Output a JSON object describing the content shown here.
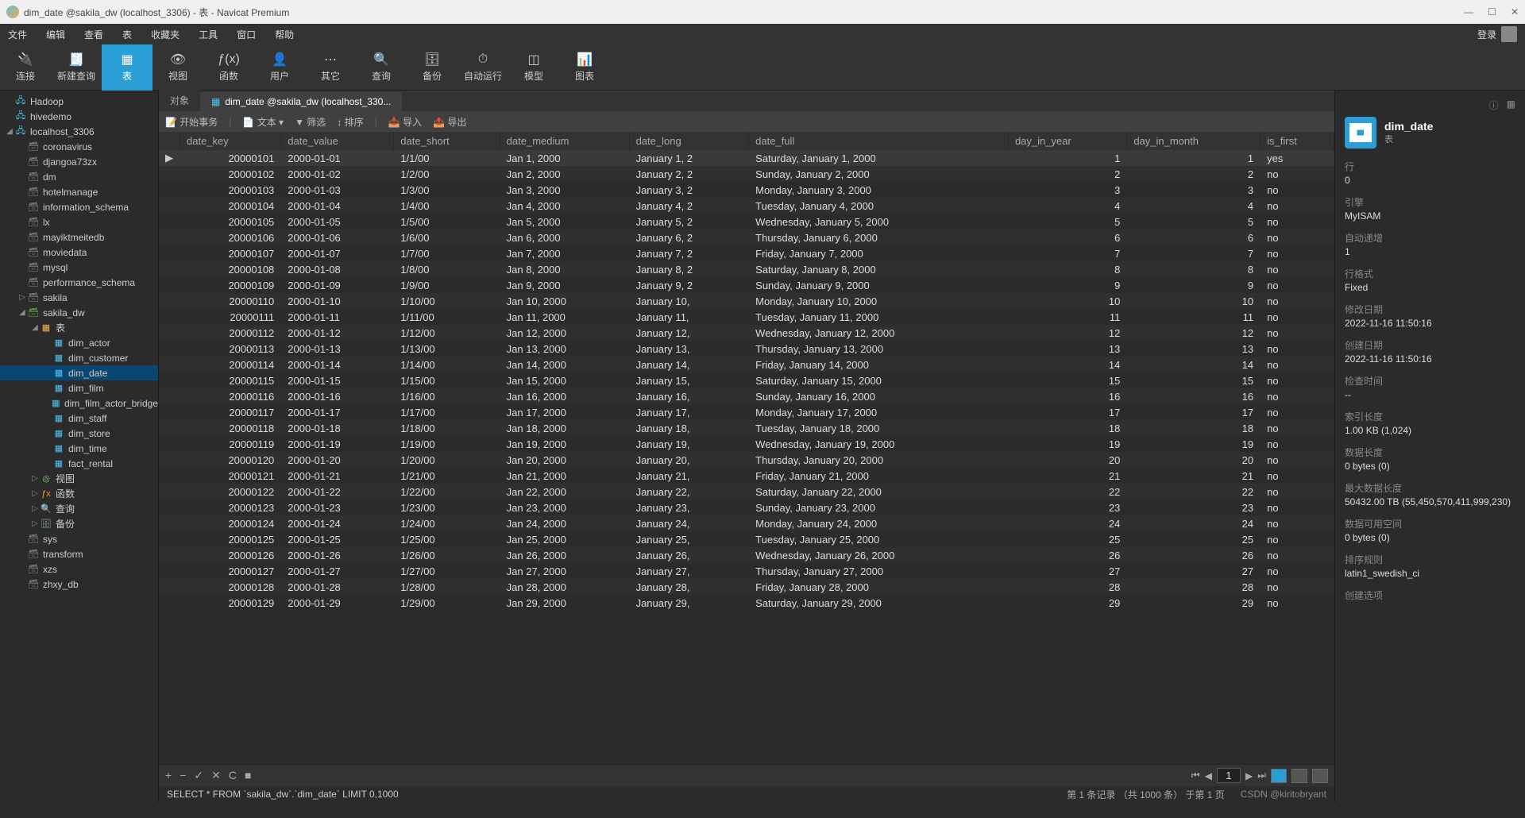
{
  "title": "dim_date @sakila_dw (localhost_3306) - 表 - Navicat Premium",
  "menu": [
    "文件",
    "编辑",
    "查看",
    "表",
    "收藏夹",
    "工具",
    "窗口",
    "帮助"
  ],
  "login": "登录",
  "toolbar": [
    {
      "label": "连接",
      "icon": "🔌"
    },
    {
      "label": "新建查询",
      "icon": "🧾"
    },
    {
      "label": "表",
      "icon": "▦",
      "active": true
    },
    {
      "label": "视图",
      "icon": "👁"
    },
    {
      "label": "函数",
      "icon": "ƒ(x)"
    },
    {
      "label": "用户",
      "icon": "👤"
    },
    {
      "label": "其它",
      "icon": "⋯"
    },
    {
      "label": "查询",
      "icon": "🔍"
    },
    {
      "label": "备份",
      "icon": "🗄"
    },
    {
      "label": "自动运行",
      "icon": "⏱"
    },
    {
      "label": "模型",
      "icon": "◫"
    },
    {
      "label": "图表",
      "icon": "📊"
    }
  ],
  "tree": [
    {
      "d": 0,
      "tw": "",
      "ic": "ic-conn",
      "glyph": "🖧",
      "label": "Hadoop"
    },
    {
      "d": 0,
      "tw": "",
      "ic": "ic-conn",
      "glyph": "🖧",
      "label": "hivedemo"
    },
    {
      "d": 0,
      "tw": "◢",
      "ic": "ic-conn",
      "glyph": "🖧",
      "label": "localhost_3306"
    },
    {
      "d": 1,
      "tw": "",
      "ic": "ic-dbgrey",
      "glyph": "🗃",
      "label": "coronavirus"
    },
    {
      "d": 1,
      "tw": "",
      "ic": "ic-dbgrey",
      "glyph": "🗃",
      "label": "djangoa73zx"
    },
    {
      "d": 1,
      "tw": "",
      "ic": "ic-dbgrey",
      "glyph": "🗃",
      "label": "dm"
    },
    {
      "d": 1,
      "tw": "",
      "ic": "ic-dbgrey",
      "glyph": "🗃",
      "label": "hotelmanage"
    },
    {
      "d": 1,
      "tw": "",
      "ic": "ic-dbgrey",
      "glyph": "🗃",
      "label": "information_schema"
    },
    {
      "d": 1,
      "tw": "",
      "ic": "ic-dbgrey",
      "glyph": "🗃",
      "label": "lx"
    },
    {
      "d": 1,
      "tw": "",
      "ic": "ic-dbgrey",
      "glyph": "🗃",
      "label": "mayiktmeitedb"
    },
    {
      "d": 1,
      "tw": "",
      "ic": "ic-dbgrey",
      "glyph": "🗃",
      "label": "moviedata"
    },
    {
      "d": 1,
      "tw": "",
      "ic": "ic-dbgrey",
      "glyph": "🗃",
      "label": "mysql"
    },
    {
      "d": 1,
      "tw": "",
      "ic": "ic-dbgrey",
      "glyph": "🗃",
      "label": "performance_schema"
    },
    {
      "d": 1,
      "tw": "▷",
      "ic": "ic-dbgrey",
      "glyph": "🗃",
      "label": "sakila"
    },
    {
      "d": 1,
      "tw": "◢",
      "ic": "ic-db",
      "glyph": "🗃",
      "label": "sakila_dw"
    },
    {
      "d": 2,
      "tw": "◢",
      "ic": "ic-folder",
      "glyph": "▦",
      "label": "表"
    },
    {
      "d": 3,
      "tw": "",
      "ic": "ic-table",
      "glyph": "▦",
      "label": "dim_actor"
    },
    {
      "d": 3,
      "tw": "",
      "ic": "ic-table",
      "glyph": "▦",
      "label": "dim_customer"
    },
    {
      "d": 3,
      "tw": "",
      "ic": "ic-table",
      "glyph": "▦",
      "label": "dim_date",
      "sel": true
    },
    {
      "d": 3,
      "tw": "",
      "ic": "ic-table",
      "glyph": "▦",
      "label": "dim_film"
    },
    {
      "d": 3,
      "tw": "",
      "ic": "ic-table",
      "glyph": "▦",
      "label": "dim_film_actor_bridge"
    },
    {
      "d": 3,
      "tw": "",
      "ic": "ic-table",
      "glyph": "▦",
      "label": "dim_staff"
    },
    {
      "d": 3,
      "tw": "",
      "ic": "ic-table",
      "glyph": "▦",
      "label": "dim_store"
    },
    {
      "d": 3,
      "tw": "",
      "ic": "ic-table",
      "glyph": "▦",
      "label": "dim_time"
    },
    {
      "d": 3,
      "tw": "",
      "ic": "ic-table",
      "glyph": "▦",
      "label": "fact_rental"
    },
    {
      "d": 2,
      "tw": "▷",
      "ic": "ic-view",
      "glyph": "◎",
      "label": "视图"
    },
    {
      "d": 2,
      "tw": "▷",
      "ic": "ic-func",
      "glyph": "ƒx",
      "label": "函数"
    },
    {
      "d": 2,
      "tw": "▷",
      "ic": "ic-query",
      "glyph": "🔍",
      "label": "查询"
    },
    {
      "d": 2,
      "tw": "▷",
      "ic": "ic-backup",
      "glyph": "🗄",
      "label": "备份"
    },
    {
      "d": 1,
      "tw": "",
      "ic": "ic-dbgrey",
      "glyph": "🗃",
      "label": "sys"
    },
    {
      "d": 1,
      "tw": "",
      "ic": "ic-dbgrey",
      "glyph": "🗃",
      "label": "transform"
    },
    {
      "d": 1,
      "tw": "",
      "ic": "ic-dbgrey",
      "glyph": "🗃",
      "label": "xzs"
    },
    {
      "d": 1,
      "tw": "",
      "ic": "ic-dbgrey",
      "glyph": "🗃",
      "label": "zhxy_db"
    }
  ],
  "tabs": [
    {
      "label": "对象",
      "active": false
    },
    {
      "label": "dim_date @sakila_dw (localhost_330...",
      "active": true,
      "icon": "▦"
    }
  ],
  "subtoolbar": {
    "begin": "开始事务",
    "text": "文本",
    "filter": "筛选",
    "sort": "排序",
    "import": "导入",
    "export": "导出"
  },
  "columns": [
    "date_key",
    "date_value",
    "date_short",
    "date_medium",
    "date_long",
    "date_full",
    "day_in_year",
    "day_in_month",
    "is_first"
  ],
  "rows": [
    [
      "20000101",
      "2000-01-01",
      "1/1/00",
      "Jan 1, 2000",
      "January 1, 2",
      "Saturday, January 1, 2000",
      "1",
      "1",
      "yes"
    ],
    [
      "20000102",
      "2000-01-02",
      "1/2/00",
      "Jan 2, 2000",
      "January 2, 2",
      "Sunday, January 2, 2000",
      "2",
      "2",
      "no"
    ],
    [
      "20000103",
      "2000-01-03",
      "1/3/00",
      "Jan 3, 2000",
      "January 3, 2",
      "Monday, January 3, 2000",
      "3",
      "3",
      "no"
    ],
    [
      "20000104",
      "2000-01-04",
      "1/4/00",
      "Jan 4, 2000",
      "January 4, 2",
      "Tuesday, January 4, 2000",
      "4",
      "4",
      "no"
    ],
    [
      "20000105",
      "2000-01-05",
      "1/5/00",
      "Jan 5, 2000",
      "January 5, 2",
      "Wednesday, January 5, 2000",
      "5",
      "5",
      "no"
    ],
    [
      "20000106",
      "2000-01-06",
      "1/6/00",
      "Jan 6, 2000",
      "January 6, 2",
      "Thursday, January 6, 2000",
      "6",
      "6",
      "no"
    ],
    [
      "20000107",
      "2000-01-07",
      "1/7/00",
      "Jan 7, 2000",
      "January 7, 2",
      "Friday, January 7, 2000",
      "7",
      "7",
      "no"
    ],
    [
      "20000108",
      "2000-01-08",
      "1/8/00",
      "Jan 8, 2000",
      "January 8, 2",
      "Saturday, January 8, 2000",
      "8",
      "8",
      "no"
    ],
    [
      "20000109",
      "2000-01-09",
      "1/9/00",
      "Jan 9, 2000",
      "January 9, 2",
      "Sunday, January 9, 2000",
      "9",
      "9",
      "no"
    ],
    [
      "20000110",
      "2000-01-10",
      "1/10/00",
      "Jan 10, 2000",
      "January 10,",
      "Monday, January 10, 2000",
      "10",
      "10",
      "no"
    ],
    [
      "20000111",
      "2000-01-11",
      "1/11/00",
      "Jan 11, 2000",
      "January 11,",
      "Tuesday, January 11, 2000",
      "11",
      "11",
      "no"
    ],
    [
      "20000112",
      "2000-01-12",
      "1/12/00",
      "Jan 12, 2000",
      "January 12,",
      "Wednesday, January 12, 2000",
      "12",
      "12",
      "no"
    ],
    [
      "20000113",
      "2000-01-13",
      "1/13/00",
      "Jan 13, 2000",
      "January 13,",
      "Thursday, January 13, 2000",
      "13",
      "13",
      "no"
    ],
    [
      "20000114",
      "2000-01-14",
      "1/14/00",
      "Jan 14, 2000",
      "January 14,",
      "Friday, January 14, 2000",
      "14",
      "14",
      "no"
    ],
    [
      "20000115",
      "2000-01-15",
      "1/15/00",
      "Jan 15, 2000",
      "January 15,",
      "Saturday, January 15, 2000",
      "15",
      "15",
      "no"
    ],
    [
      "20000116",
      "2000-01-16",
      "1/16/00",
      "Jan 16, 2000",
      "January 16,",
      "Sunday, January 16, 2000",
      "16",
      "16",
      "no"
    ],
    [
      "20000117",
      "2000-01-17",
      "1/17/00",
      "Jan 17, 2000",
      "January 17,",
      "Monday, January 17, 2000",
      "17",
      "17",
      "no"
    ],
    [
      "20000118",
      "2000-01-18",
      "1/18/00",
      "Jan 18, 2000",
      "January 18,",
      "Tuesday, January 18, 2000",
      "18",
      "18",
      "no"
    ],
    [
      "20000119",
      "2000-01-19",
      "1/19/00",
      "Jan 19, 2000",
      "January 19,",
      "Wednesday, January 19, 2000",
      "19",
      "19",
      "no"
    ],
    [
      "20000120",
      "2000-01-20",
      "1/20/00",
      "Jan 20, 2000",
      "January 20,",
      "Thursday, January 20, 2000",
      "20",
      "20",
      "no"
    ],
    [
      "20000121",
      "2000-01-21",
      "1/21/00",
      "Jan 21, 2000",
      "January 21,",
      "Friday, January 21, 2000",
      "21",
      "21",
      "no"
    ],
    [
      "20000122",
      "2000-01-22",
      "1/22/00",
      "Jan 22, 2000",
      "January 22,",
      "Saturday, January 22, 2000",
      "22",
      "22",
      "no"
    ],
    [
      "20000123",
      "2000-01-23",
      "1/23/00",
      "Jan 23, 2000",
      "January 23,",
      "Sunday, January 23, 2000",
      "23",
      "23",
      "no"
    ],
    [
      "20000124",
      "2000-01-24",
      "1/24/00",
      "Jan 24, 2000",
      "January 24,",
      "Monday, January 24, 2000",
      "24",
      "24",
      "no"
    ],
    [
      "20000125",
      "2000-01-25",
      "1/25/00",
      "Jan 25, 2000",
      "January 25,",
      "Tuesday, January 25, 2000",
      "25",
      "25",
      "no"
    ],
    [
      "20000126",
      "2000-01-26",
      "1/26/00",
      "Jan 26, 2000",
      "January 26,",
      "Wednesday, January 26, 2000",
      "26",
      "26",
      "no"
    ],
    [
      "20000127",
      "2000-01-27",
      "1/27/00",
      "Jan 27, 2000",
      "January 27,",
      "Thursday, January 27, 2000",
      "27",
      "27",
      "no"
    ],
    [
      "20000128",
      "2000-01-28",
      "1/28/00",
      "Jan 28, 2000",
      "January 28,",
      "Friday, January 28, 2000",
      "28",
      "28",
      "no"
    ],
    [
      "20000129",
      "2000-01-29",
      "1/29/00",
      "Jan 29, 2000",
      "January 29,",
      "Saturday, January 29, 2000",
      "29",
      "29",
      "no"
    ]
  ],
  "sql": "SELECT * FROM `sakila_dw`.`dim_date` LIMIT 0,1000",
  "recinfo": "第 1 条记录 （共 1000 条） 于第 1 页",
  "watermark": "CSDN @kiritobryant",
  "page": "1",
  "props": {
    "title": "dim_date",
    "type": "表",
    "items": [
      {
        "k": "行",
        "v": "0"
      },
      {
        "k": "引擎",
        "v": "MyISAM"
      },
      {
        "k": "自动递增",
        "v": "1"
      },
      {
        "k": "行格式",
        "v": "Fixed"
      },
      {
        "k": "修改日期",
        "v": "2022-11-16 11:50:16"
      },
      {
        "k": "创建日期",
        "v": "2022-11-16 11:50:16"
      },
      {
        "k": "检查时间",
        "v": "--"
      },
      {
        "k": "索引长度",
        "v": "1.00 KB (1,024)"
      },
      {
        "k": "数据长度",
        "v": "0 bytes (0)"
      },
      {
        "k": "最大数据长度",
        "v": "50432.00 TB (55,450,570,411,999,230)"
      },
      {
        "k": "数据可用空间",
        "v": "0 bytes (0)"
      },
      {
        "k": "排序规则",
        "v": "latin1_swedish_ci"
      },
      {
        "k": "创建选项",
        "v": ""
      }
    ]
  }
}
